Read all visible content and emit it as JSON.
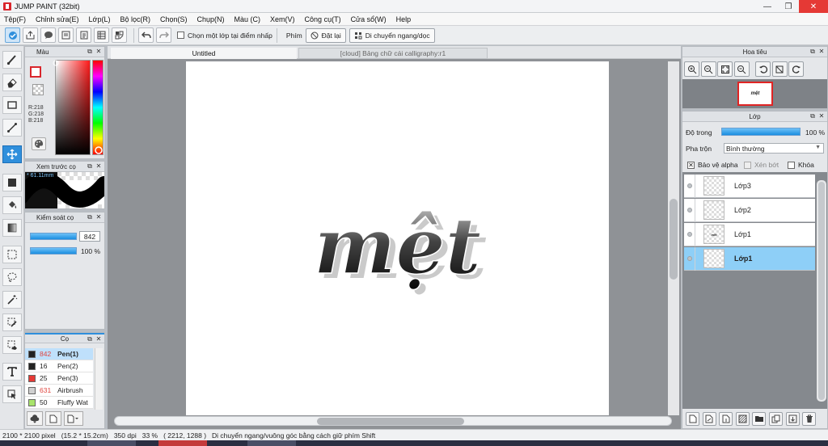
{
  "window": {
    "title": "JUMP PAINT (32bit)",
    "controls": {
      "minimize": "—",
      "maximize": "❐",
      "close": "✕"
    }
  },
  "menu": [
    "Tệp(F)",
    "Chỉnh sửa(E)",
    "Lớp(L)",
    "Bộ lọc(R)",
    "Chọn(S)",
    "Chụp(N)",
    "Màu (C)",
    "Xem(V)",
    "Công cụ(T)",
    "Cửa sổ(W)",
    "Help"
  ],
  "toolbar": {
    "select_from_point_label": "Chọn một lớp tại điểm nhấp",
    "keys_label": "Phím",
    "reset_label": "Đặt lại",
    "move_hv_label": "Di chuyển ngang/dọc"
  },
  "panels": {
    "color": {
      "title": "Màu",
      "r": "R:218",
      "g": "G:218",
      "b": "B:218",
      "fg_color": "#d9262c"
    },
    "preview": {
      "title": "Xem trước cọ",
      "size": "61.11mm"
    },
    "brush_control": {
      "title": "Kiểm soát cọ",
      "size_value": "842",
      "opacity_value": "100 %"
    },
    "brushes": {
      "title": "Cọ",
      "items": [
        {
          "size": "842",
          "name": "Pen(1)",
          "color": "#222222",
          "selected": true,
          "highlight": true
        },
        {
          "size": "16",
          "name": "Pen(2)",
          "color": "#222222",
          "selected": false,
          "highlight": false
        },
        {
          "size": "25",
          "name": "Pen(3)",
          "color": "#e53935",
          "selected": false,
          "highlight": false
        },
        {
          "size": "631",
          "name": "Airbrush",
          "color": "#d0d0d0",
          "selected": false,
          "highlight": true
        },
        {
          "size": "50",
          "name": "Fluffy Wat",
          "color": "#a8e36b",
          "selected": false,
          "highlight": false
        }
      ]
    },
    "navigator": {
      "title": "Hoa tiêu",
      "thumb_text": "mệt"
    },
    "layers": {
      "title": "Lớp",
      "opacity_label": "Độ trong",
      "opacity_value": "100 %",
      "blend_label": "Pha trộn",
      "blend_value": "Bình thường",
      "protect_alpha_label": "Bảo vệ alpha",
      "clip_label": "Xén bớt",
      "lock_label": "Khóa",
      "items": [
        {
          "name": "Lớp3",
          "selected": false,
          "thumb": ""
        },
        {
          "name": "Lớp2",
          "selected": false,
          "thumb": ""
        },
        {
          "name": "Lớp1",
          "selected": false,
          "thumb": "mệt"
        },
        {
          "name": "Lớp1",
          "selected": true,
          "thumb": ""
        }
      ]
    }
  },
  "tabs": [
    {
      "label": "Untitled",
      "active": true
    },
    {
      "label": "[cloud] Bảng chữ cái calligraphy:r1",
      "active": false
    }
  ],
  "artwork": {
    "text": "mệt",
    "accent": "#111111",
    "shadow": "#c9c9c9"
  },
  "status": {
    "dimensions": "2100 * 2100 pixel",
    "physical": "(15.2 * 15.2cm)",
    "dpi": "350 dpi",
    "zoom": "33 %",
    "cursor": "( 2212, 1288 )",
    "hint": "Di chuyển ngang/vuông góc bằng cách giữ phím Shift"
  },
  "colors": {
    "accent": "#2f8fdc",
    "close_red": "#e53935"
  }
}
